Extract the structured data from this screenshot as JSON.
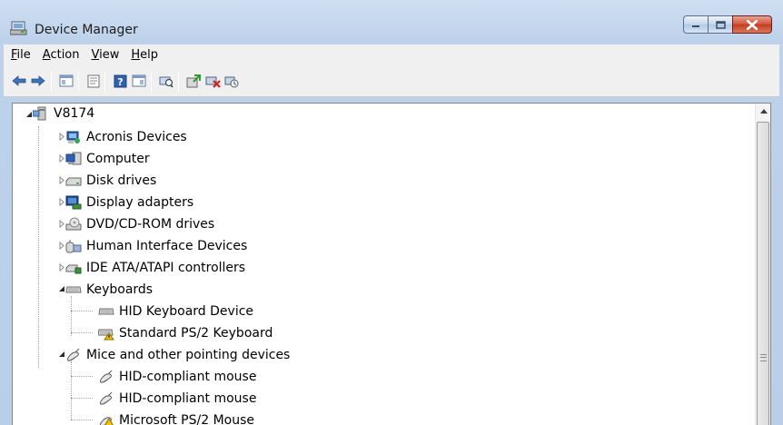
{
  "window": {
    "title": "Device Manager",
    "icon": "device-manager-icon"
  },
  "menubar": {
    "file": "File",
    "action": "Action",
    "view": "View",
    "help": "Help"
  },
  "toolbar": {
    "icons": [
      "back-arrow-icon",
      "forward-arrow-icon",
      "show-hide-console-tree-icon",
      "properties-icon",
      "help-icon",
      "view-icon",
      "scan-hardware-icon",
      "update-driver-icon",
      "uninstall-icon",
      "disable-icon"
    ]
  },
  "tree": {
    "root": "V8174",
    "categories": {
      "acronis": "Acronis Devices",
      "computer": "Computer",
      "disk": "Disk drives",
      "display": "Display adapters",
      "dvd": "DVD/CD-ROM drives",
      "hid": "Human Interface Devices",
      "ide": "IDE ATA/ATAPI controllers",
      "keyboards": "Keyboards",
      "mice": "Mice and other pointing devices"
    },
    "keyboards_children": [
      "HID Keyboard Device",
      "Standard PS/2 Keyboard"
    ],
    "mice_children": [
      "HID-compliant mouse",
      "HID-compliant mouse",
      "Microsoft PS/2 Mouse"
    ]
  },
  "colors": {
    "title_bg": "#c3d7ee",
    "close_button": "#c8432b",
    "warning_badge": "#f2c200"
  }
}
